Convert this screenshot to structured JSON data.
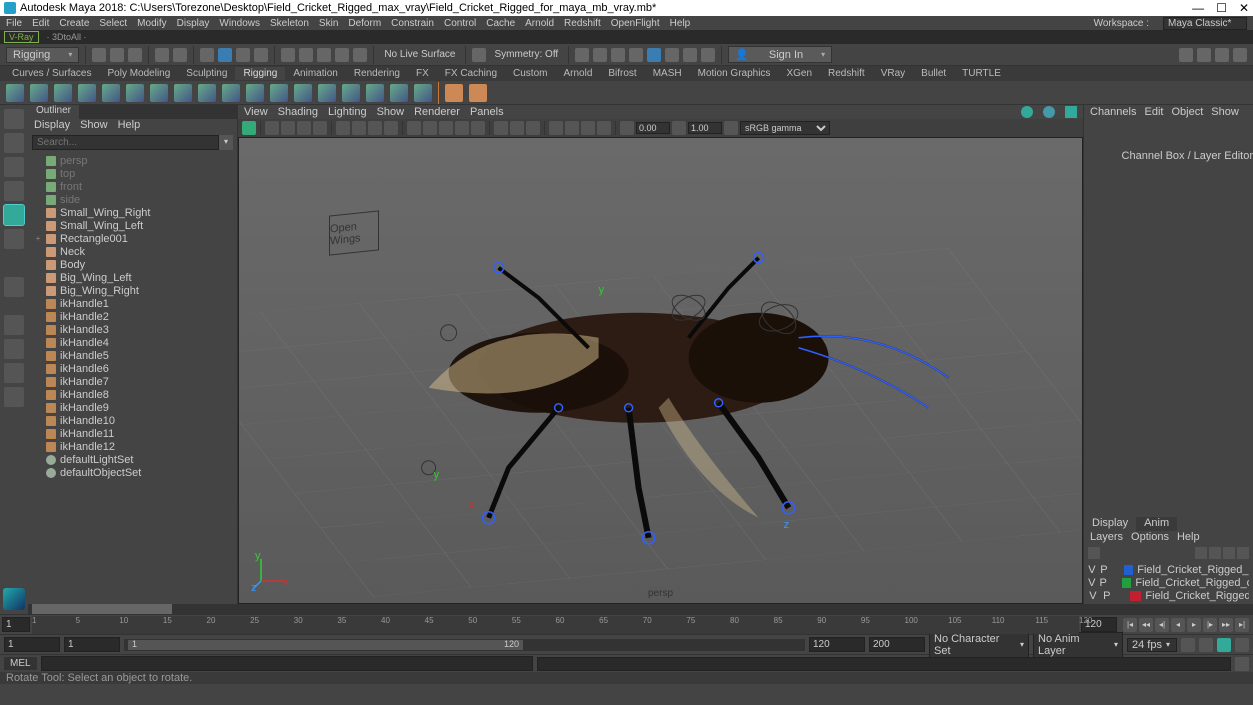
{
  "title": "Autodesk Maya 2018: C:\\Users\\Torezone\\Desktop\\Field_Cricket_Rigged_max_vray\\Field_Cricket_Rigged_for_maya_mb_vray.mb*",
  "menubar": [
    "File",
    "Edit",
    "Create",
    "Select",
    "Modify",
    "Display",
    "Windows",
    "Skeleton",
    "Skin",
    "Deform",
    "Constrain",
    "Control",
    "Cache",
    "Arnold",
    "Redshift",
    "OpenFlight",
    "Help"
  ],
  "workspace_label": "Workspace :",
  "workspace_value": "Maya Classic*",
  "statusline": {
    "vray": "V-Ray",
    "threed": "· 3DtoAll ·"
  },
  "shelf": {
    "mode": "Rigging",
    "no_live": "No Live Surface",
    "symmetry": "Symmetry: Off",
    "signin": "Sign In"
  },
  "tabs": [
    "Curves / Surfaces",
    "Poly Modeling",
    "Sculpting",
    "Rigging",
    "Animation",
    "Rendering",
    "FX",
    "FX Caching",
    "Custom",
    "Arnold",
    "Bifrost",
    "MASH",
    "Motion Graphics",
    "XGen",
    "Redshift",
    "VRay",
    "Bullet",
    "TURTLE"
  ],
  "tabs_active": "Rigging",
  "outliner": {
    "title": "Outliner",
    "menu": [
      "Display",
      "Show",
      "Help"
    ],
    "search": "Search...",
    "nodes": [
      {
        "label": "persp",
        "dim": true,
        "type": "cam"
      },
      {
        "label": "top",
        "dim": true,
        "type": "cam"
      },
      {
        "label": "front",
        "dim": true,
        "type": "cam"
      },
      {
        "label": "side",
        "dim": true,
        "type": "cam"
      },
      {
        "label": "Small_Wing_Right",
        "type": "mesh"
      },
      {
        "label": "Small_Wing_Left",
        "type": "mesh"
      },
      {
        "label": "Rectangle001",
        "type": "mesh",
        "exp": "+"
      },
      {
        "label": "Neck",
        "type": "mesh"
      },
      {
        "label": "Body",
        "type": "mesh"
      },
      {
        "label": "Big_Wing_Left",
        "type": "mesh"
      },
      {
        "label": "Big_Wing_Right",
        "type": "mesh"
      },
      {
        "label": "ikHandle1",
        "type": "ik"
      },
      {
        "label": "ikHandle2",
        "type": "ik"
      },
      {
        "label": "ikHandle3",
        "type": "ik"
      },
      {
        "label": "ikHandle4",
        "type": "ik"
      },
      {
        "label": "ikHandle5",
        "type": "ik"
      },
      {
        "label": "ikHandle6",
        "type": "ik"
      },
      {
        "label": "ikHandle7",
        "type": "ik"
      },
      {
        "label": "ikHandle8",
        "type": "ik"
      },
      {
        "label": "ikHandle9",
        "type": "ik"
      },
      {
        "label": "ikHandle10",
        "type": "ik"
      },
      {
        "label": "ikHandle11",
        "type": "ik"
      },
      {
        "label": "ikHandle12",
        "type": "ik"
      },
      {
        "label": "defaultLightSet",
        "type": "set"
      },
      {
        "label": "defaultObjectSet",
        "type": "set"
      }
    ]
  },
  "viewport": {
    "menu": [
      "View",
      "Shading",
      "Lighting",
      "Show",
      "Renderer",
      "Panels"
    ],
    "exposure": "0.00",
    "gamma": "1.00",
    "colorspace": "sRGB gamma",
    "camera": "persp",
    "box_label": "Open Wings"
  },
  "channels": {
    "menu": [
      "Channels",
      "Edit",
      "Object",
      "Show"
    ],
    "tabs": [
      "Display",
      "Anim"
    ],
    "menu2": [
      "Layers",
      "Options",
      "Help"
    ],
    "layers": [
      {
        "v": "V",
        "p": "P",
        "color": "blue",
        "name": "Field_Cricket_Rigged_bones"
      },
      {
        "v": "V",
        "p": "P",
        "color": "green",
        "name": "Field_Cricket_Rigged_controlls"
      },
      {
        "v": "V",
        "p": "P",
        "color": "red",
        "name": "Field_Cricket_Rigged"
      }
    ],
    "sidetab": "Channel Box / Layer Editor"
  },
  "timeline": {
    "ticks": [
      "1",
      "5",
      "10",
      "15",
      "20",
      "25",
      "30",
      "35",
      "40",
      "45",
      "50",
      "55",
      "60",
      "65",
      "70",
      "75",
      "80",
      "85",
      "90",
      "95",
      "100",
      "105",
      "110",
      "115",
      "120"
    ],
    "start_frame": "1",
    "end_frame": "120",
    "range_start": "1",
    "range_end_1": "1",
    "range_track_label": "1",
    "range_in": "120",
    "range_out": "120",
    "anim_start": "120",
    "anim_end": "200",
    "charset": "No Character Set",
    "animlayer": "No Anim Layer",
    "fps": "24 fps"
  },
  "cmd": {
    "lang": "MEL"
  },
  "help": "Rotate Tool: Select an object to rotate."
}
